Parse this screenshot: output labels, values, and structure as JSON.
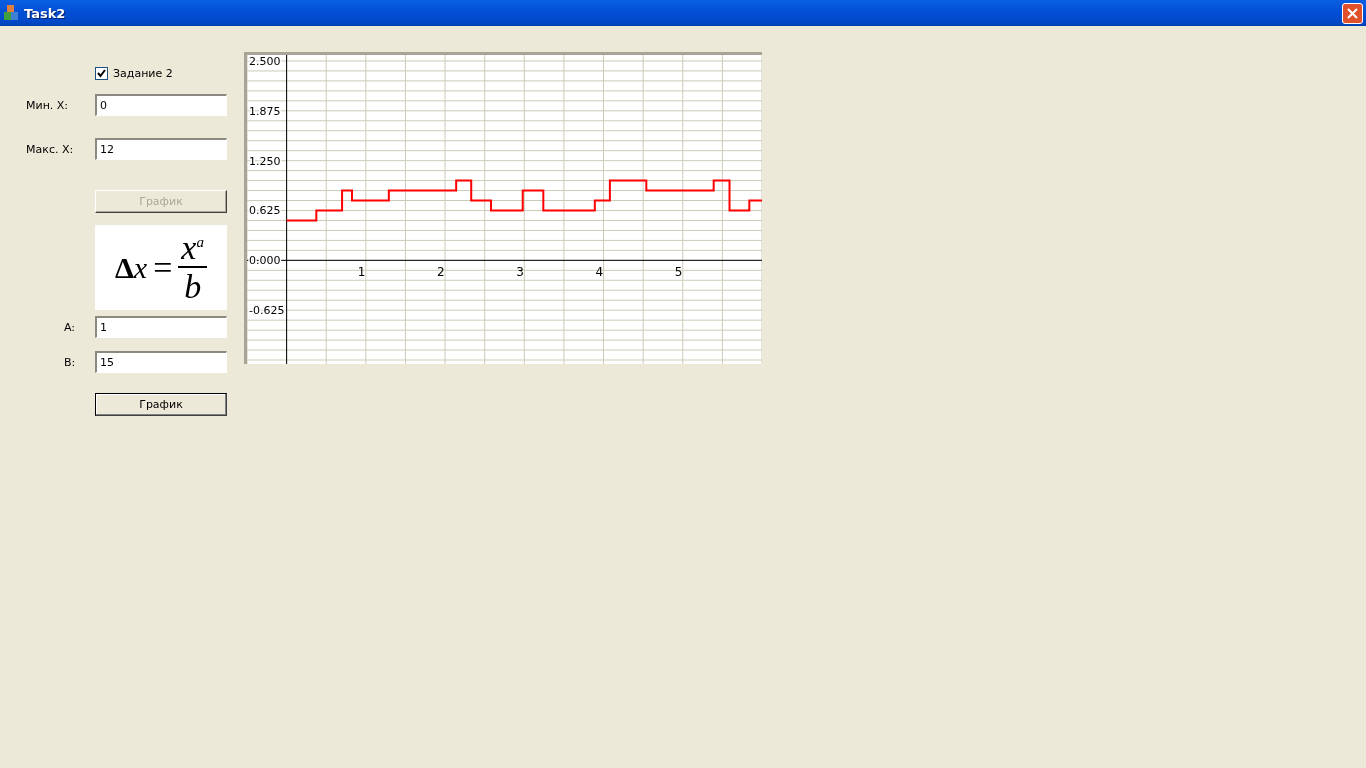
{
  "window": {
    "title": "Task2"
  },
  "task_checkbox": {
    "label": "Задание 2",
    "checked": true
  },
  "range_fields": [
    {
      "label": "Мин. X:",
      "value": "0"
    },
    {
      "label": "Макс. X:",
      "value": "12"
    }
  ],
  "plot_button_top": {
    "label": "График",
    "disabled": true
  },
  "formula": {
    "delta": "Δ",
    "variable": "x",
    "equals": "=",
    "numerator": "x",
    "exponent": "a",
    "denominator": "b"
  },
  "coefficient_fields": [
    {
      "label": "A:",
      "value": "1"
    },
    {
      "label": "B:",
      "value": "15"
    }
  ],
  "plot_button_bottom": {
    "label": "График",
    "disabled": false
  },
  "chart_data": {
    "type": "line",
    "xlim": [
      -0.5,
      6
    ],
    "ylim": [
      -1.3,
      2.575
    ],
    "xticks": [
      1,
      2,
      3,
      4,
      5
    ],
    "yticks": [
      {
        "value": 2.5,
        "label": "2.500"
      },
      {
        "value": 1.875,
        "label": "1.875"
      },
      {
        "value": 1.25,
        "label": "1.250"
      },
      {
        "value": 0.625,
        "label": "0.625"
      },
      {
        "value": 0,
        "label": "0.000"
      },
      {
        "value": -0.625,
        "label": "-0.625"
      }
    ],
    "grid": true,
    "x": [
      0,
      0.375,
      0.375,
      0.7,
      0.7,
      0.825,
      0.825,
      1.29,
      1.29,
      2.14,
      2.14,
      2.33,
      2.33,
      2.58,
      2.58,
      2.98,
      2.98,
      3.24,
      3.24,
      3.89,
      3.89,
      4.08,
      4.08,
      4.54,
      4.54,
      5.39,
      5.39,
      5.59,
      5.59,
      5.84,
      5.84,
      6
    ],
    "series": [
      {
        "color": "#ff0000",
        "values": [
          0.5,
          0.5,
          0.625,
          0.625,
          0.875,
          0.875,
          0.75,
          0.75,
          0.875,
          0.875,
          1.0,
          1.0,
          0.75,
          0.75,
          0.625,
          0.625,
          0.875,
          0.875,
          0.625,
          0.625,
          0.75,
          0.75,
          1.0,
          1.0,
          0.875,
          0.875,
          1.0,
          1.0,
          0.625,
          0.625,
          0.75,
          0.75
        ]
      }
    ]
  }
}
